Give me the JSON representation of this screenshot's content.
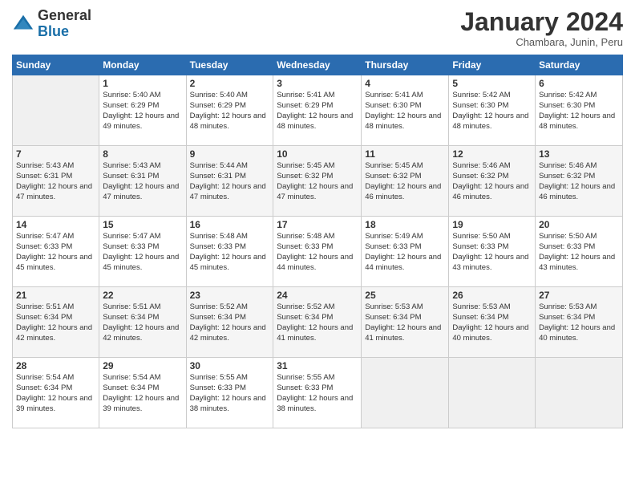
{
  "header": {
    "logo_general": "General",
    "logo_blue": "Blue",
    "month_title": "January 2024",
    "subtitle": "Chambara, Junin, Peru"
  },
  "columns": [
    "Sunday",
    "Monday",
    "Tuesday",
    "Wednesday",
    "Thursday",
    "Friday",
    "Saturday"
  ],
  "weeks": [
    [
      {
        "day": "",
        "empty": true
      },
      {
        "day": "1",
        "sunrise": "5:40 AM",
        "sunset": "6:29 PM",
        "daylight": "12 hours and 49 minutes."
      },
      {
        "day": "2",
        "sunrise": "5:40 AM",
        "sunset": "6:29 PM",
        "daylight": "12 hours and 48 minutes."
      },
      {
        "day": "3",
        "sunrise": "5:41 AM",
        "sunset": "6:29 PM",
        "daylight": "12 hours and 48 minutes."
      },
      {
        "day": "4",
        "sunrise": "5:41 AM",
        "sunset": "6:30 PM",
        "daylight": "12 hours and 48 minutes."
      },
      {
        "day": "5",
        "sunrise": "5:42 AM",
        "sunset": "6:30 PM",
        "daylight": "12 hours and 48 minutes."
      },
      {
        "day": "6",
        "sunrise": "5:42 AM",
        "sunset": "6:30 PM",
        "daylight": "12 hours and 48 minutes."
      }
    ],
    [
      {
        "day": "7",
        "sunrise": "5:43 AM",
        "sunset": "6:31 PM",
        "daylight": "12 hours and 47 minutes."
      },
      {
        "day": "8",
        "sunrise": "5:43 AM",
        "sunset": "6:31 PM",
        "daylight": "12 hours and 47 minutes."
      },
      {
        "day": "9",
        "sunrise": "5:44 AM",
        "sunset": "6:31 PM",
        "daylight": "12 hours and 47 minutes."
      },
      {
        "day": "10",
        "sunrise": "5:45 AM",
        "sunset": "6:32 PM",
        "daylight": "12 hours and 47 minutes."
      },
      {
        "day": "11",
        "sunrise": "5:45 AM",
        "sunset": "6:32 PM",
        "daylight": "12 hours and 46 minutes."
      },
      {
        "day": "12",
        "sunrise": "5:46 AM",
        "sunset": "6:32 PM",
        "daylight": "12 hours and 46 minutes."
      },
      {
        "day": "13",
        "sunrise": "5:46 AM",
        "sunset": "6:32 PM",
        "daylight": "12 hours and 46 minutes."
      }
    ],
    [
      {
        "day": "14",
        "sunrise": "5:47 AM",
        "sunset": "6:33 PM",
        "daylight": "12 hours and 45 minutes."
      },
      {
        "day": "15",
        "sunrise": "5:47 AM",
        "sunset": "6:33 PM",
        "daylight": "12 hours and 45 minutes."
      },
      {
        "day": "16",
        "sunrise": "5:48 AM",
        "sunset": "6:33 PM",
        "daylight": "12 hours and 45 minutes."
      },
      {
        "day": "17",
        "sunrise": "5:48 AM",
        "sunset": "6:33 PM",
        "daylight": "12 hours and 44 minutes."
      },
      {
        "day": "18",
        "sunrise": "5:49 AM",
        "sunset": "6:33 PM",
        "daylight": "12 hours and 44 minutes."
      },
      {
        "day": "19",
        "sunrise": "5:50 AM",
        "sunset": "6:33 PM",
        "daylight": "12 hours and 43 minutes."
      },
      {
        "day": "20",
        "sunrise": "5:50 AM",
        "sunset": "6:33 PM",
        "daylight": "12 hours and 43 minutes."
      }
    ],
    [
      {
        "day": "21",
        "sunrise": "5:51 AM",
        "sunset": "6:34 PM",
        "daylight": "12 hours and 42 minutes."
      },
      {
        "day": "22",
        "sunrise": "5:51 AM",
        "sunset": "6:34 PM",
        "daylight": "12 hours and 42 minutes."
      },
      {
        "day": "23",
        "sunrise": "5:52 AM",
        "sunset": "6:34 PM",
        "daylight": "12 hours and 42 minutes."
      },
      {
        "day": "24",
        "sunrise": "5:52 AM",
        "sunset": "6:34 PM",
        "daylight": "12 hours and 41 minutes."
      },
      {
        "day": "25",
        "sunrise": "5:53 AM",
        "sunset": "6:34 PM",
        "daylight": "12 hours and 41 minutes."
      },
      {
        "day": "26",
        "sunrise": "5:53 AM",
        "sunset": "6:34 PM",
        "daylight": "12 hours and 40 minutes."
      },
      {
        "day": "27",
        "sunrise": "5:53 AM",
        "sunset": "6:34 PM",
        "daylight": "12 hours and 40 minutes."
      }
    ],
    [
      {
        "day": "28",
        "sunrise": "5:54 AM",
        "sunset": "6:34 PM",
        "daylight": "12 hours and 39 minutes."
      },
      {
        "day": "29",
        "sunrise": "5:54 AM",
        "sunset": "6:34 PM",
        "daylight": "12 hours and 39 minutes."
      },
      {
        "day": "30",
        "sunrise": "5:55 AM",
        "sunset": "6:33 PM",
        "daylight": "12 hours and 38 minutes."
      },
      {
        "day": "31",
        "sunrise": "5:55 AM",
        "sunset": "6:33 PM",
        "daylight": "12 hours and 38 minutes."
      },
      {
        "day": "",
        "empty": true
      },
      {
        "day": "",
        "empty": true
      },
      {
        "day": "",
        "empty": true
      }
    ]
  ],
  "labels": {
    "sunrise_prefix": "Sunrise: ",
    "sunset_prefix": "Sunset: ",
    "daylight_prefix": "Daylight: "
  }
}
